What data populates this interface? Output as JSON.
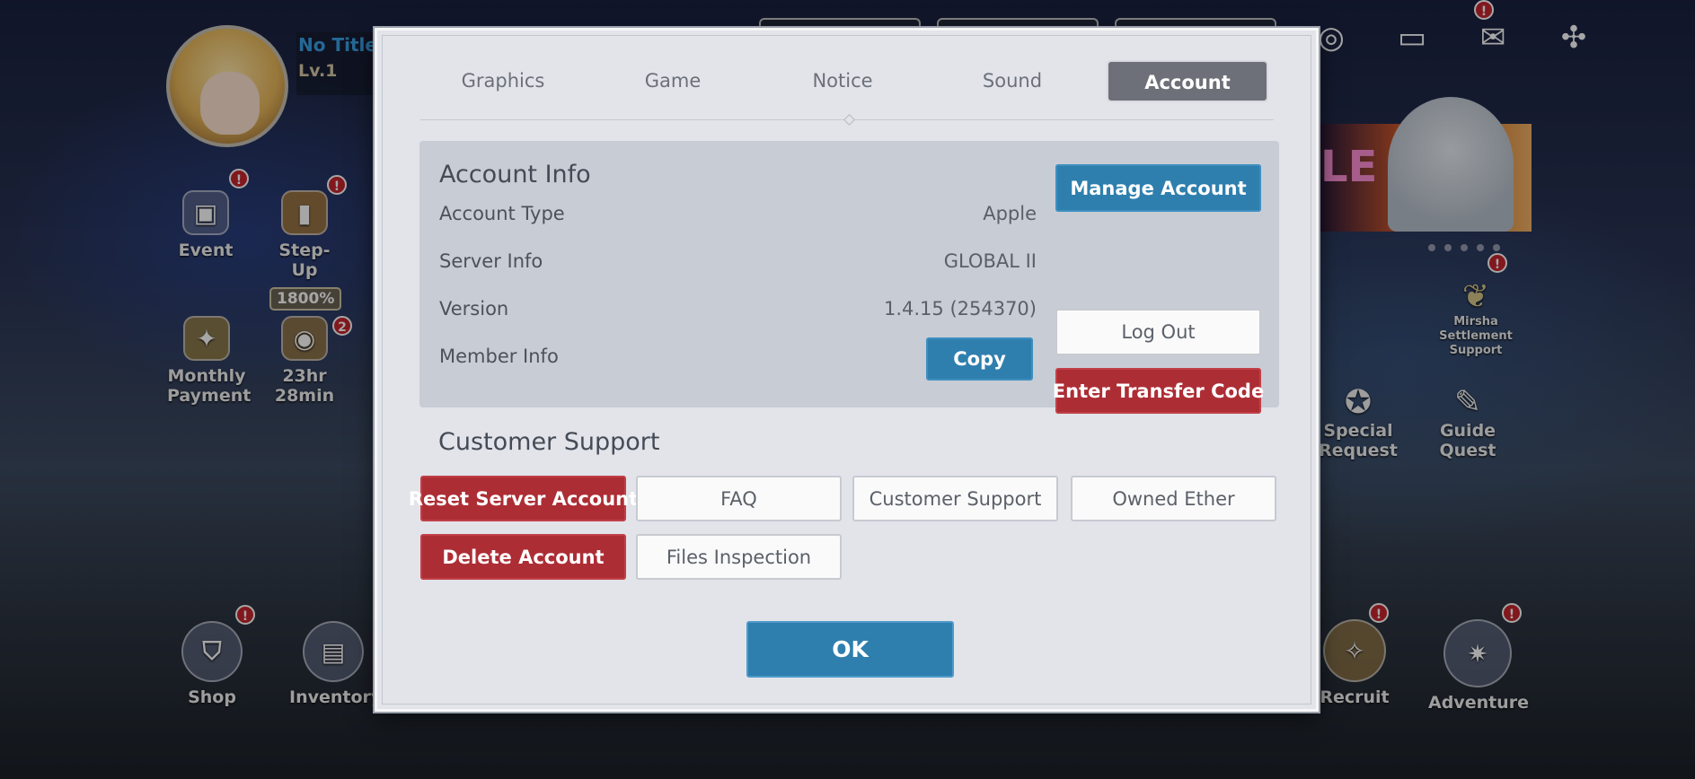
{
  "hud": {
    "player_title": "No Title",
    "player_level": "Lv.1",
    "event_label": "Event",
    "stepup_label": "Step-Up",
    "boost_percent": "1800%",
    "monthly_label": "Monthly Payment",
    "timer_label": "23hr 28min",
    "timer_badge": "2",
    "shop_label": "Shop",
    "inventory_label": "Inventory",
    "mirsha_label": "Mirsha Settlement Support",
    "special_request_label": "Special Request",
    "guide_quest_label": "Guide Quest",
    "recruit_label": "Recruit",
    "adventure_label": "Adventure",
    "banner_text": "LE S",
    "alert_badge": "!"
  },
  "tabs": [
    {
      "label": "Graphics",
      "active": false
    },
    {
      "label": "Game",
      "active": false
    },
    {
      "label": "Notice",
      "active": false
    },
    {
      "label": "Sound",
      "active": false
    },
    {
      "label": "Account",
      "active": true
    }
  ],
  "account_info": {
    "heading": "Account Info",
    "rows": [
      {
        "label": "Account Type",
        "value": "Apple"
      },
      {
        "label": "Server Info",
        "value": "GLOBAL II"
      },
      {
        "label": "Version",
        "value": "1.4.15 (254370)"
      },
      {
        "label": "Member Info",
        "value": ""
      }
    ],
    "copy_button": "Copy",
    "manage_button": "Manage Account",
    "logout_button": "Log Out",
    "transfer_button": "Enter Transfer Code"
  },
  "customer_support": {
    "heading": "Customer Support",
    "buttons": {
      "reset_server": "Reset Server Account",
      "faq": "FAQ",
      "customer_support": "Customer Support",
      "owned_ether": "Owned Ether",
      "delete_account": "Delete Account",
      "files_inspection": "Files Inspection"
    }
  },
  "ok_button": "OK",
  "colors": {
    "accent_blue": "#2f7fae",
    "danger_red": "#ad2d35",
    "tab_active": "#6d7078",
    "panel_bg": "#e2e4ea"
  }
}
